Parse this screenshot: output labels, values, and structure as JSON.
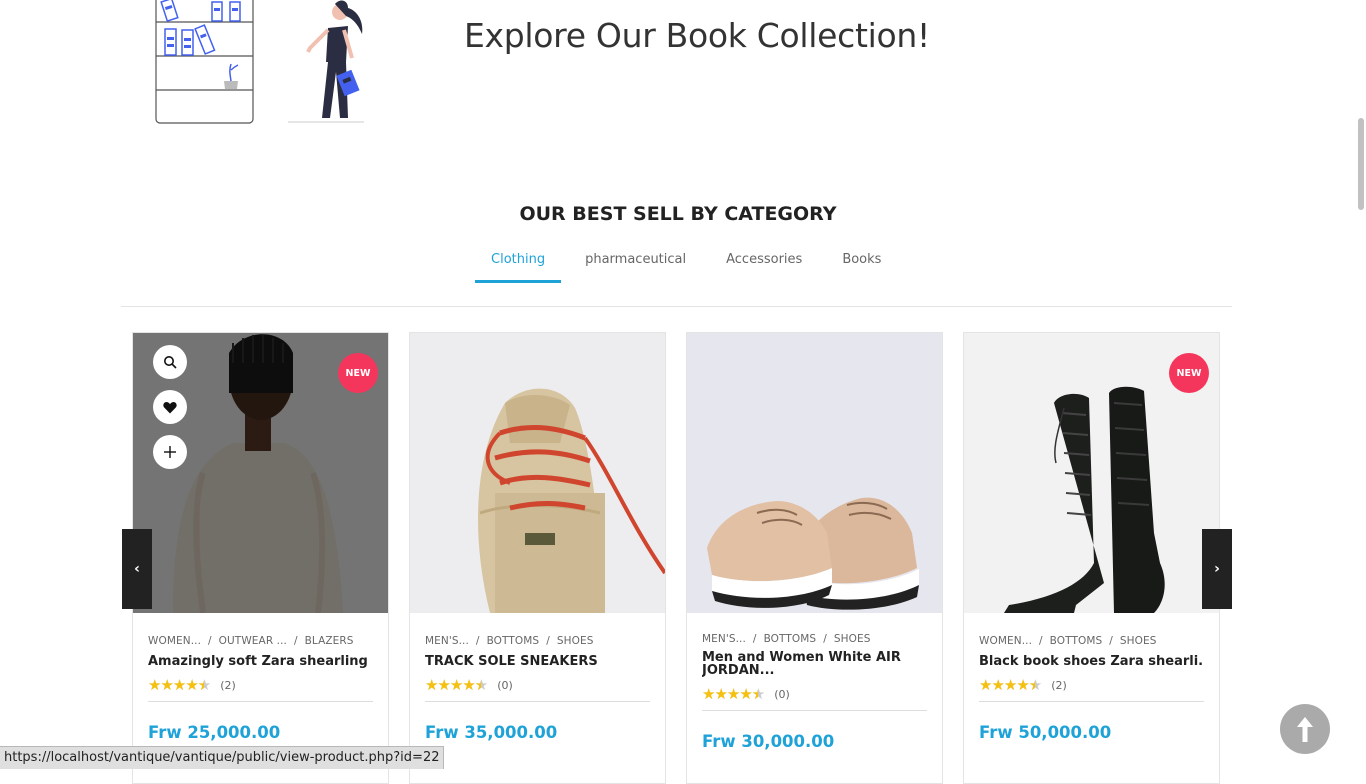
{
  "hero": {
    "title": "Explore Our Book Collection!"
  },
  "section": {
    "title": "OUR BEST SELL BY CATEGORY"
  },
  "tabs": [
    "Clothing",
    "pharmaceutical",
    "Accessories",
    "Books"
  ],
  "active_tab": "Clothing",
  "actions": [
    "search-icon",
    "heart-icon",
    "plus-icon"
  ],
  "products": [
    {
      "crumbs": [
        "WOMEN...",
        "OUTWEAR ...",
        "BLAZERS"
      ],
      "name": "Amazingly soft Zara shearling ...",
      "rating": 4.5,
      "rating_count": "(2)",
      "price": "Frw 25,000.00",
      "badge": "NEW"
    },
    {
      "crumbs": [
        "MEN'S...",
        "BOTTOMS",
        "SHOES"
      ],
      "name": "TRACK SOLE SNEAKERS",
      "rating": 4.5,
      "rating_count": "(0)",
      "price": "Frw 35,000.00",
      "badge": ""
    },
    {
      "crumbs": [
        "MEN'S...",
        "BOTTOMS",
        "SHOES"
      ],
      "name": "Men and Women White AIR JORDAN...",
      "rating": 4.5,
      "rating_count": "(0)",
      "price": "Frw 30,000.00",
      "badge": ""
    },
    {
      "crumbs": [
        "WOMEN...",
        "BOTTOMS",
        "SHOES"
      ],
      "name": "Black book shoes Zara shearli...",
      "rating": 4.5,
      "rating_count": "(2)",
      "price": "Frw 50,000.00",
      "badge": "NEW"
    }
  ],
  "carousel": {
    "prev": "‹",
    "next": "›"
  },
  "status_bar": {
    "url": "https://localhost/vantique/vantique/public/view-product.php?id=22"
  },
  "colors": {
    "accent": "#1ea2d8",
    "badge": "#f5365c",
    "star": "#f6c10e"
  }
}
